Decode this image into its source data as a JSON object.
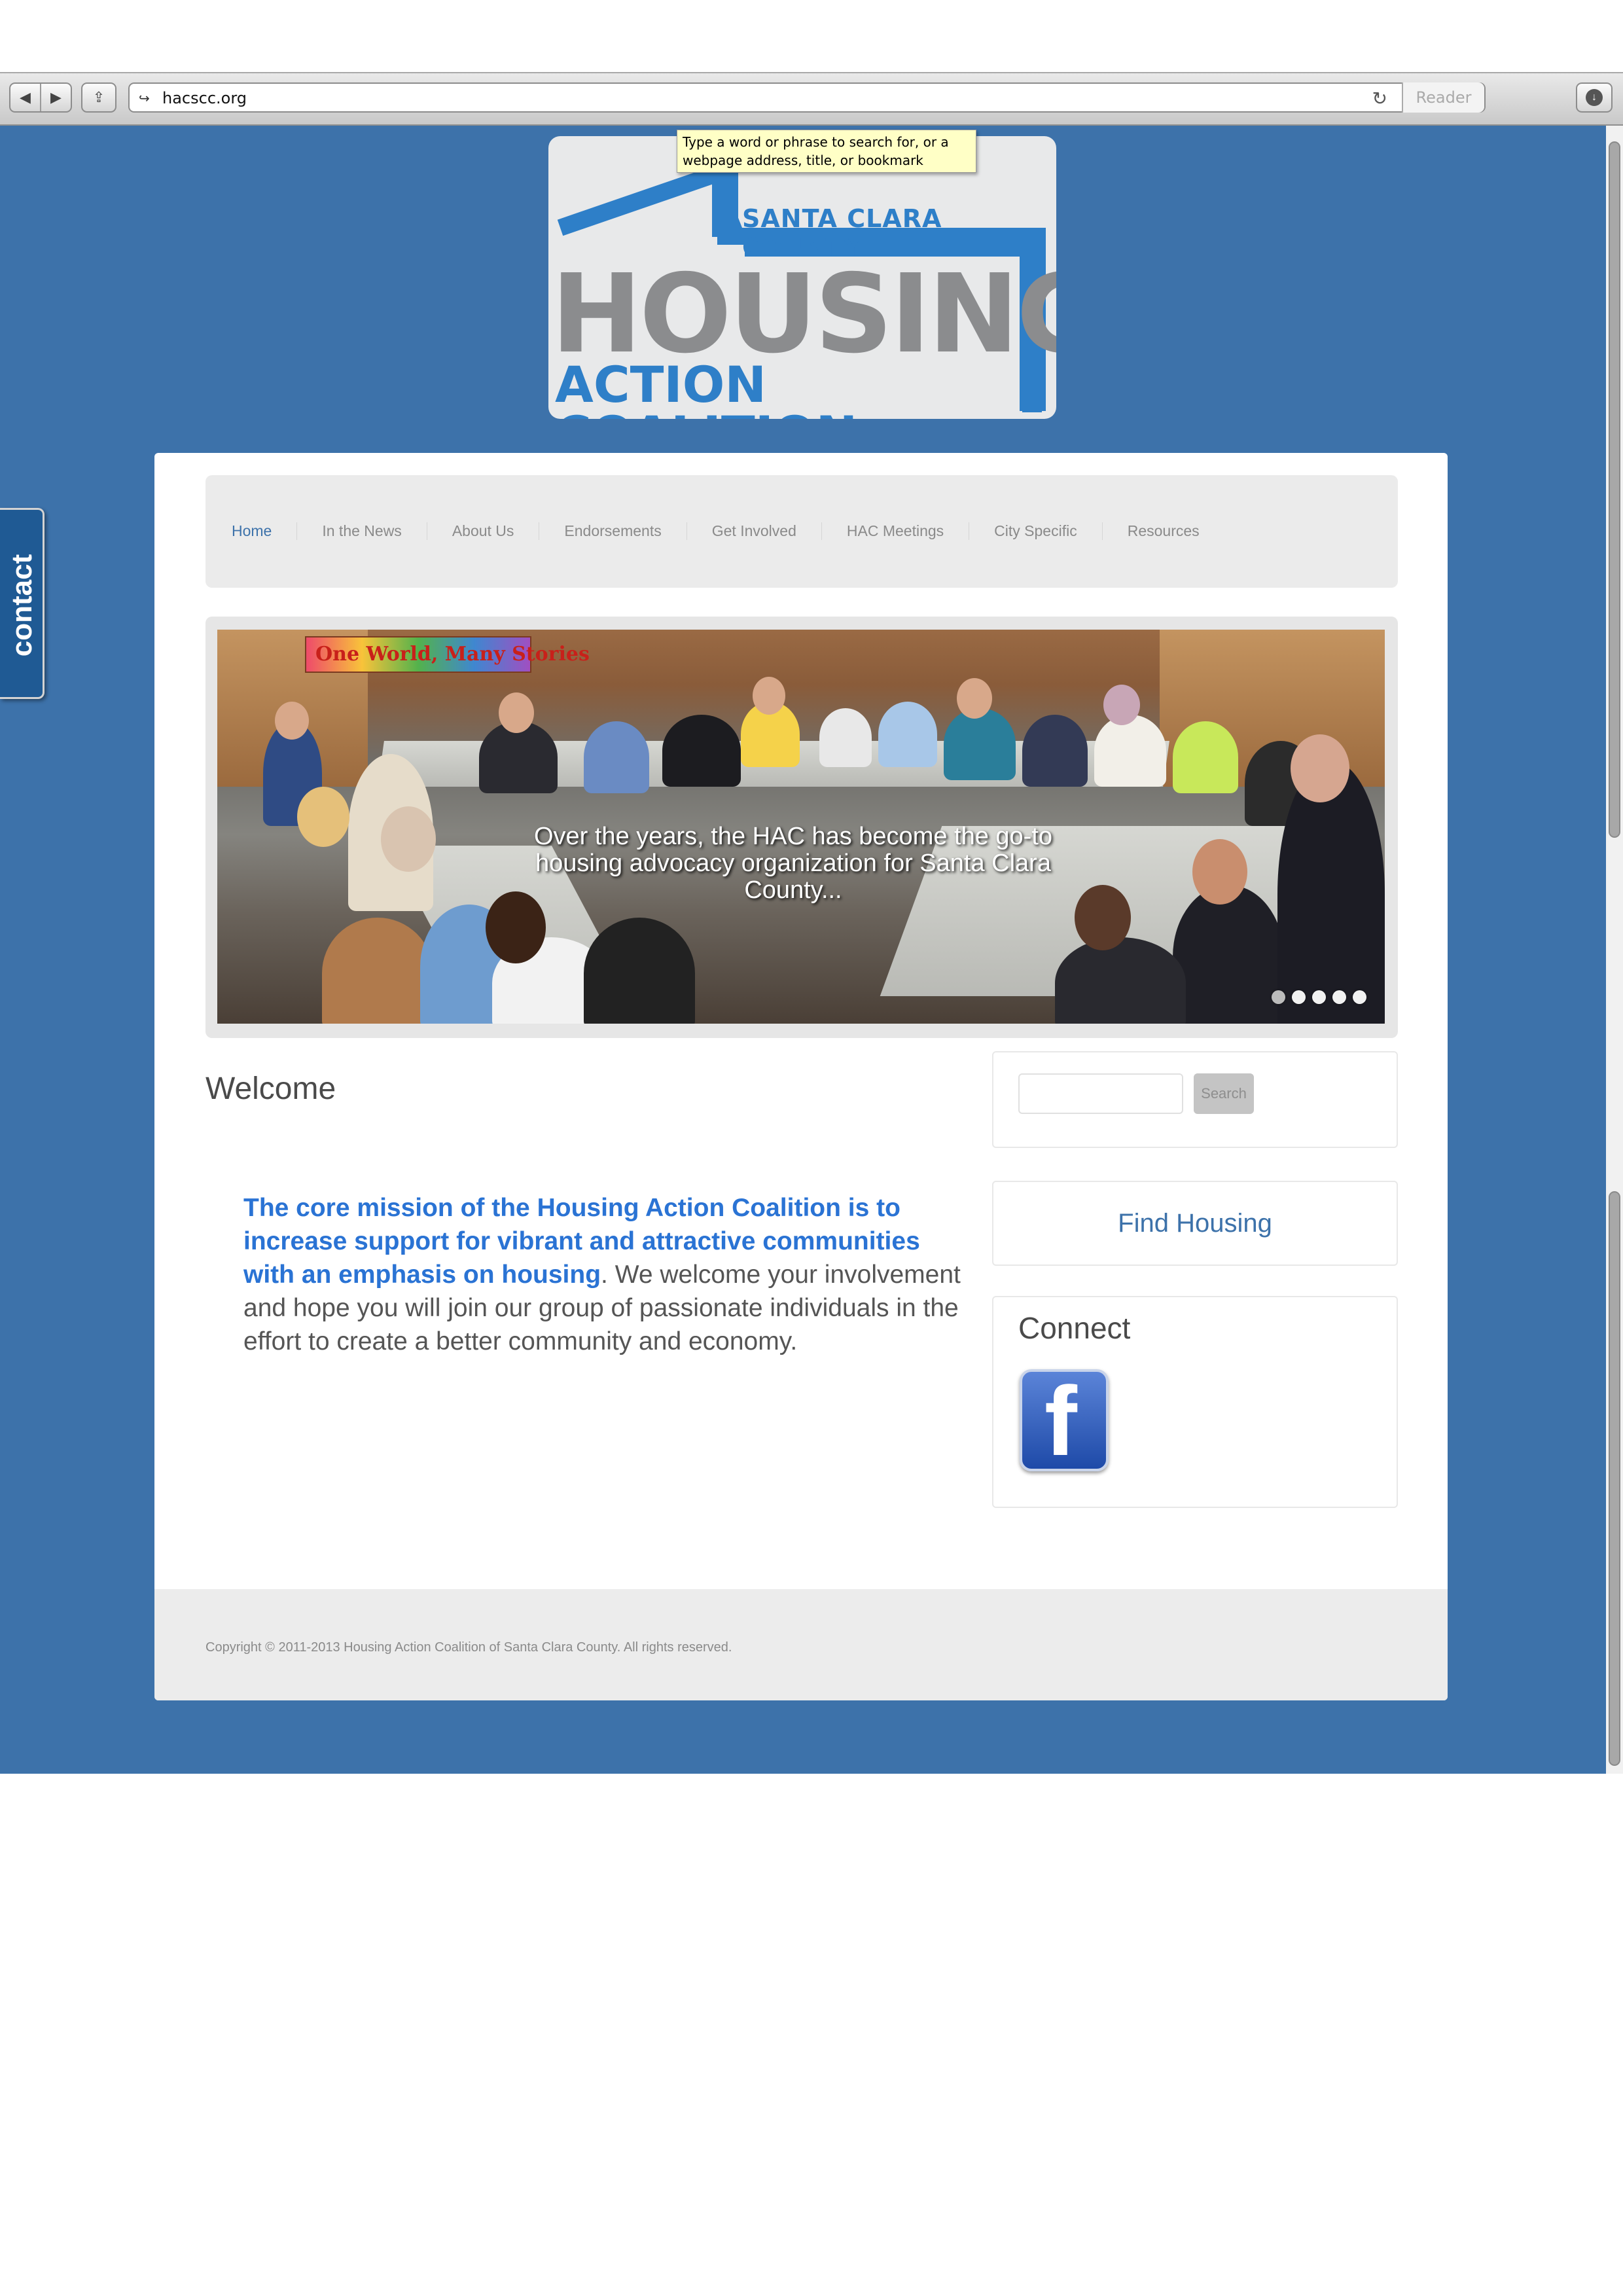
{
  "browser": {
    "url": "hacscc.org",
    "reader_label": "Reader",
    "tooltip": "Type a word or phrase to search for, or a webpage address, title, or bookmark"
  },
  "logo": {
    "line1": "SANTA CLARA COUNTY",
    "line2": "HOUSING",
    "line3": "ACTION COALITION"
  },
  "contact_tab": {
    "label": "contact"
  },
  "nav": {
    "items": [
      {
        "label": "Home",
        "active": true
      },
      {
        "label": "In the News"
      },
      {
        "label": "About Us"
      },
      {
        "label": "Endorsements"
      },
      {
        "label": "Get Involved"
      },
      {
        "label": "HAC Meetings"
      },
      {
        "label": "City Specific"
      },
      {
        "label": "Resources"
      }
    ]
  },
  "slider": {
    "banner_text": "One World, Many Stories",
    "caption": "Over the years, the HAC has become the go-to housing advocacy organization for Santa Clara County...",
    "dot_count": 5,
    "active_dot": 1
  },
  "main": {
    "welcome_heading": "Welcome",
    "mission_strong": "The core mission of the Housing Action Coalition is to increase support for vibrant and attractive communities with an emphasis on housing",
    "mission_rest": ". We welcome your involvement and hope you will join our group of passionate individuals in the effort to create a better community and economy."
  },
  "sidebar": {
    "search_button": "Search",
    "find_housing": "Find Housing",
    "connect_heading": "Connect",
    "facebook_icon": "facebook-icon"
  },
  "footer": {
    "copyright": "Copyright © 2011-2013 Housing Action Coalition of Santa Clara County. All rights reserved."
  },
  "colors": {
    "page_background": "#3d72aa",
    "brand_blue": "#2e7fc8",
    "mission_blue": "#2a73d4",
    "logo_grey": "#8b8c8e"
  }
}
